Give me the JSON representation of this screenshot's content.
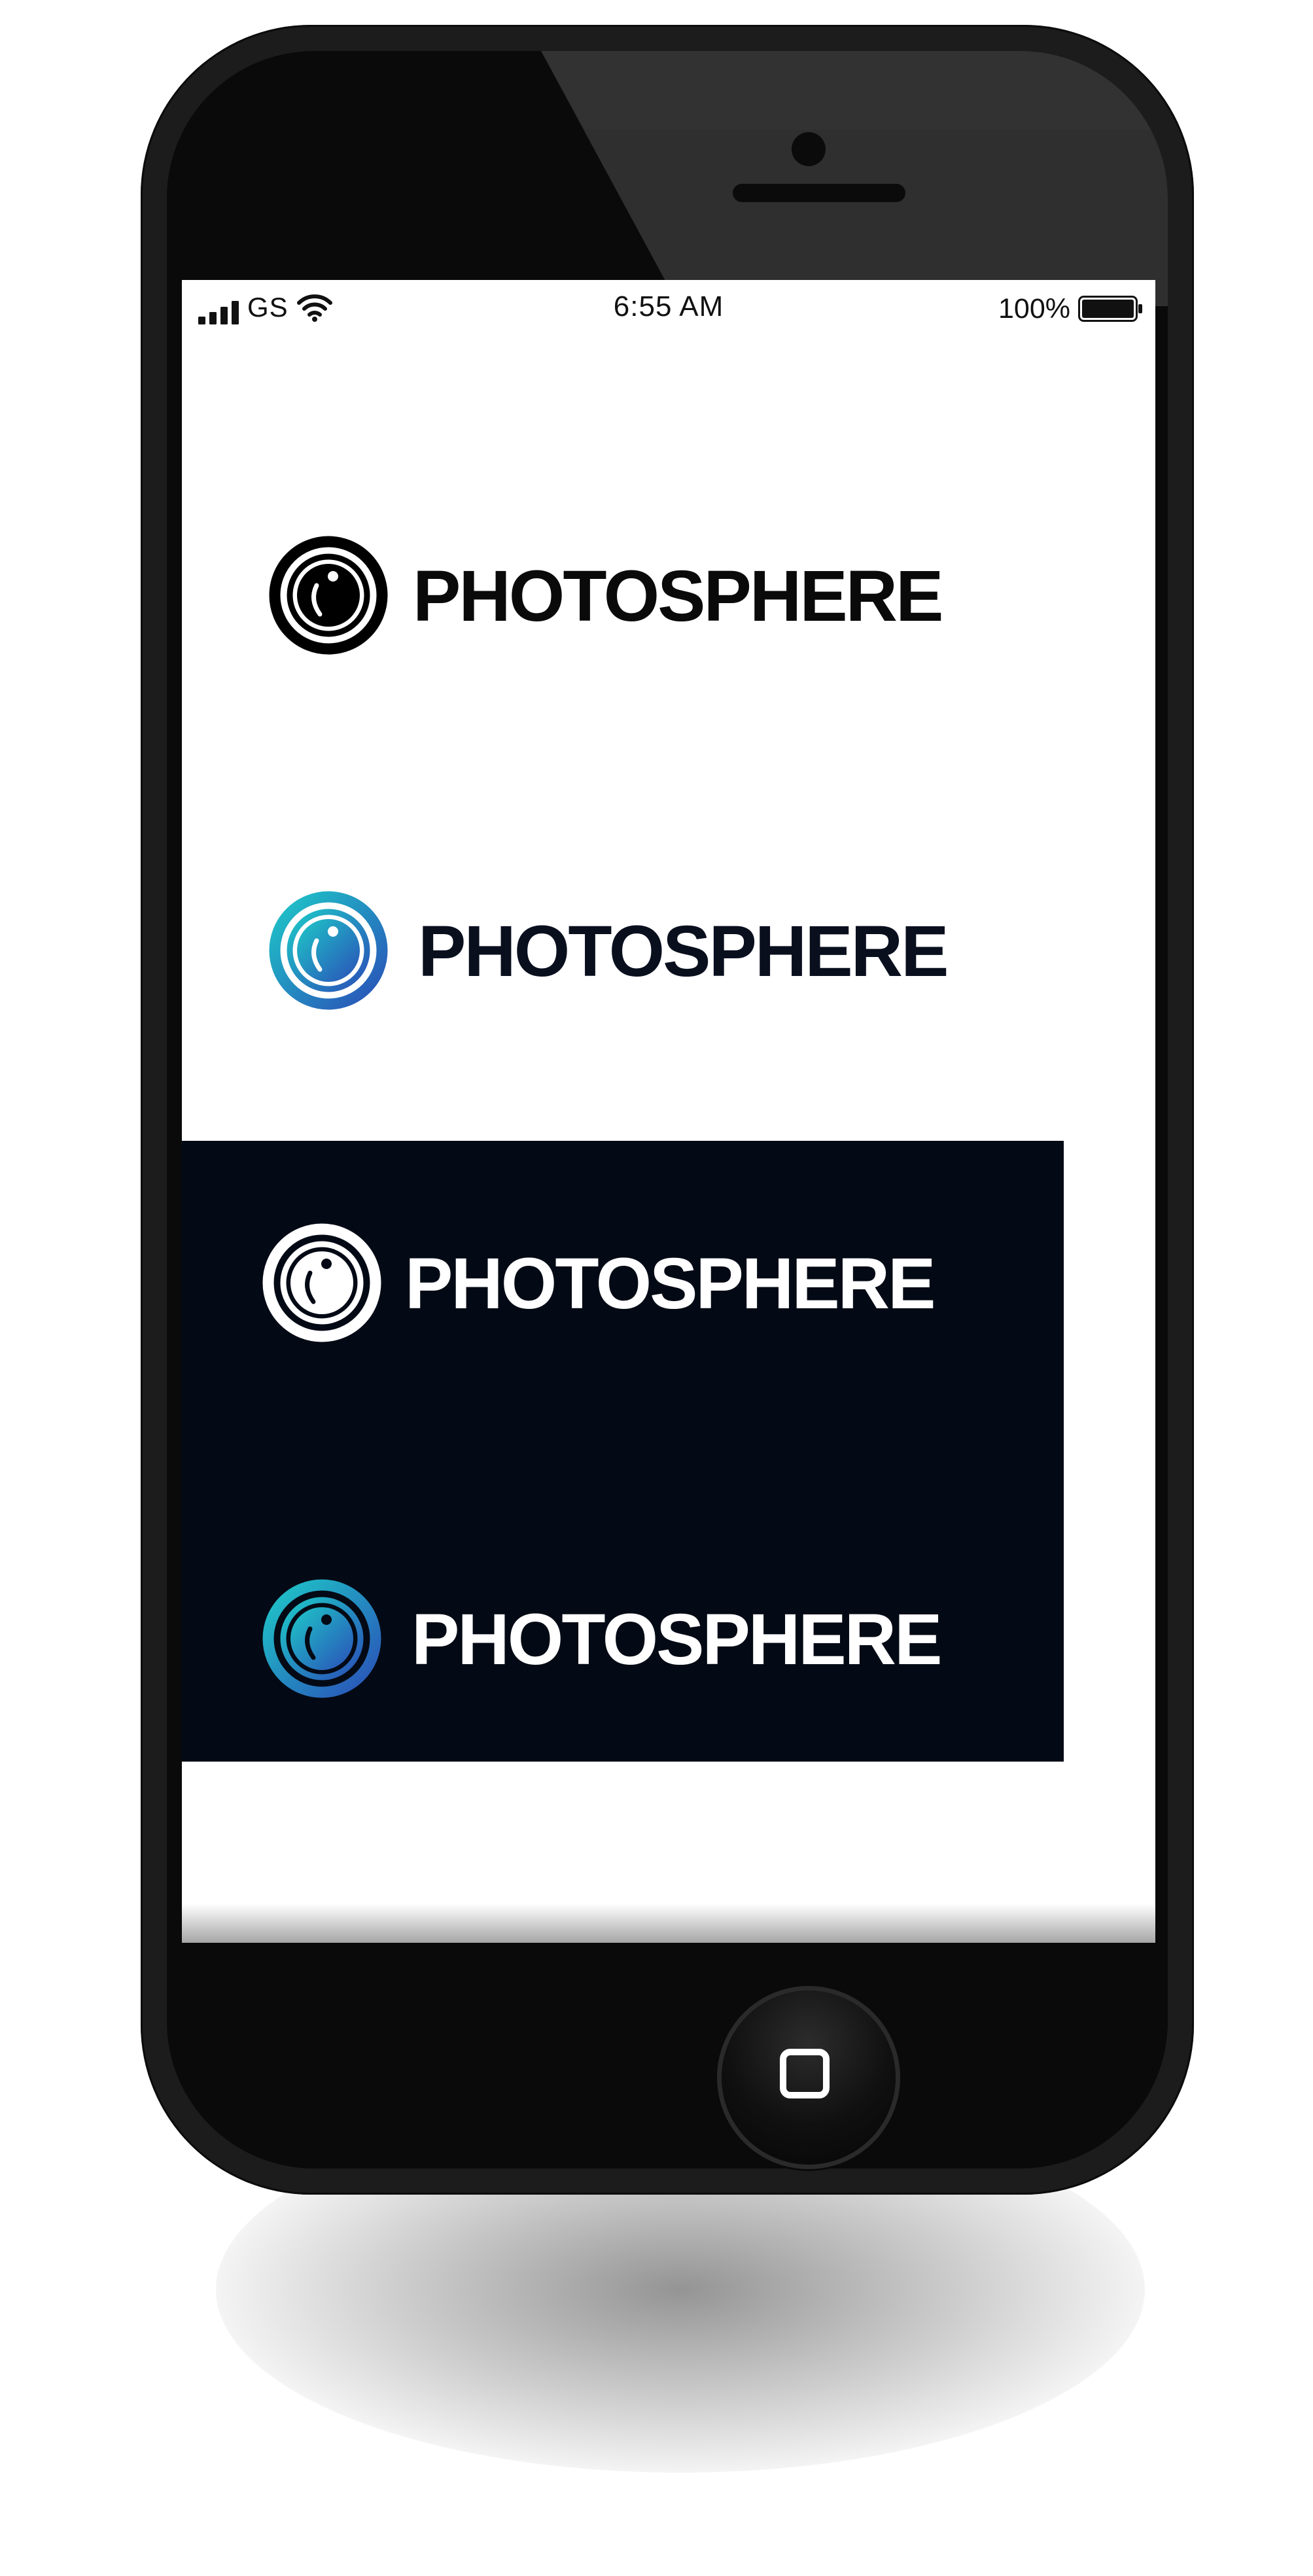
{
  "status_bar": {
    "carrier": "GS",
    "time": "6:55 AM",
    "battery_percent": "100%",
    "battery_level": 1.0,
    "icons": [
      "signal-bars-icon",
      "wifi-icon",
      "battery-icon"
    ]
  },
  "logos": [
    {
      "variant": "black-on-white",
      "text": "PHOTOSPHERE",
      "mark_color": "#000000",
      "text_color": "#0a0a0a"
    },
    {
      "variant": "gradient-on-white",
      "text": "PHOTOSPHERE",
      "mark_gradient": [
        "#1ec8c8",
        "#2a4fb8"
      ],
      "text_color": "#0a0f1e"
    },
    {
      "variant": "white-on-dark",
      "text": "PHOTOSPHERE",
      "mark_color": "#ffffff",
      "text_color": "#ffffff"
    },
    {
      "variant": "gradient-on-dark",
      "text": "PHOTOSPHERE",
      "mark_gradient": [
        "#1ec8c8",
        "#2a4fb8"
      ],
      "text_color": "#ffffff"
    }
  ],
  "colors": {
    "dark_panel": "#040a15",
    "phone_body": "#1c1c1c",
    "screen_bg": "#ffffff"
  },
  "home_button": {
    "icon": "home-square-icon"
  }
}
